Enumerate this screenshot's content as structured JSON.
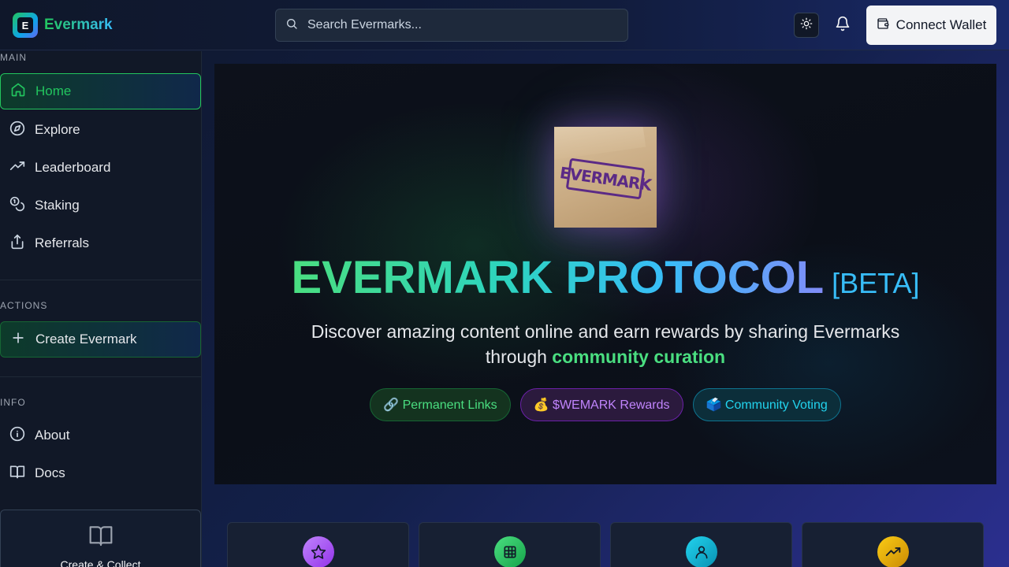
{
  "header": {
    "logo_letter": "E",
    "app_name": "Evermark",
    "search_placeholder": "Search Evermarks...",
    "theme_toggle_icon": "sun-icon",
    "notifications_icon": "bell-icon",
    "connect_wallet_label": "Connect Wallet"
  },
  "sidebar": {
    "main_label": "MAIN",
    "main_items": [
      {
        "label": "Home",
        "icon": "home-icon",
        "active": true
      },
      {
        "label": "Explore",
        "icon": "compass-icon"
      },
      {
        "label": "Leaderboard",
        "icon": "trending-icon"
      },
      {
        "label": "Staking",
        "icon": "coins-icon"
      },
      {
        "label": "Referrals",
        "icon": "share-icon"
      }
    ],
    "actions_label": "ACTIONS",
    "actions_items": [
      {
        "label": "Create Evermark",
        "icon": "plus-icon"
      }
    ],
    "info_label": "INFO",
    "info_items": [
      {
        "label": "About",
        "icon": "info-icon"
      },
      {
        "label": "Docs",
        "icon": "book-icon"
      }
    ],
    "card_text": "Create & Collect"
  },
  "hero": {
    "image_stamp_text": "EVERMARK",
    "title": "EVERMARK PROTOCOL",
    "badge": "[BETA]",
    "subtitle_start": "Discover amazing content online and earn rewards by sharing Evermarks through ",
    "subtitle_highlight": "community curation",
    "pills": [
      {
        "label": "🔗 Permanent Links",
        "color": "#4ade80"
      },
      {
        "label": "💰 $WEMARK Rewards",
        "color": "#c084fc"
      },
      {
        "label": "🗳️ Community Voting",
        "color": "#22d3ee"
      }
    ]
  },
  "feature_cards": [
    {
      "icon": "star-icon",
      "color": "#a855f7"
    },
    {
      "icon": "grid-icon",
      "color": "#22c55e"
    },
    {
      "icon": "user-icon",
      "color": "#06b6d4"
    },
    {
      "icon": "trending-up-icon",
      "color": "#eab308"
    }
  ],
  "colors": {
    "accent_green": "#22c55e",
    "accent_blue": "#38bdf8",
    "background": "#0f172a"
  }
}
